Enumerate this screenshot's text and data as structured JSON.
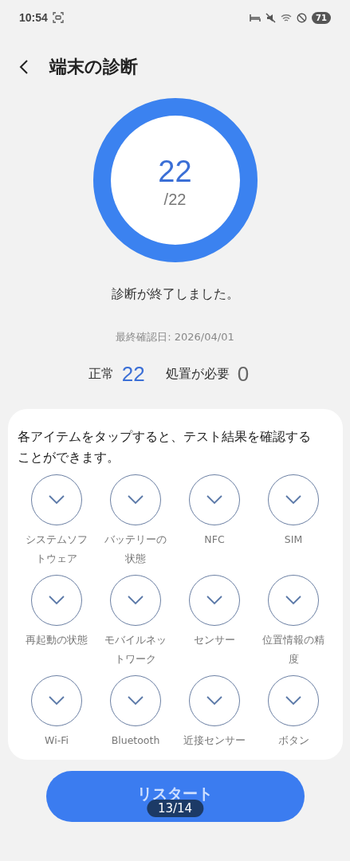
{
  "status_bar": {
    "time": "10:54",
    "battery": "71"
  },
  "header": {
    "title": "端末の診断"
  },
  "score": {
    "value": "22",
    "total": "/22",
    "level": 1
  },
  "message": "診断が終了しました。",
  "last_checked": "最終確認日: 2026/04/01",
  "counts": [
    {
      "label": "正常",
      "value": "22",
      "kind": "ok"
    },
    {
      "label": "処置が必要",
      "value": "0",
      "kind": "issue"
    }
  ],
  "card": {
    "instruction": "各アイテムをタップすると、テスト結果を確認することができます。",
    "items": [
      {
        "label": "システムソフトウェア",
        "passed": true
      },
      {
        "label": "バッテリーの状態",
        "passed": true
      },
      {
        "label": "NFC",
        "passed": true
      },
      {
        "label": "SIM",
        "passed": true
      },
      {
        "label": "再起動の状態",
        "passed": true
      },
      {
        "label": "モバイルネットワーク",
        "passed": true
      },
      {
        "label": "センサー",
        "passed": true
      },
      {
        "label": "位置情報の精度",
        "passed": true
      },
      {
        "label": "Wi-Fi",
        "passed": true
      },
      {
        "label": "Bluetooth",
        "passed": true
      },
      {
        "label": "近接センサー",
        "passed": true
      },
      {
        "label": "ボタン",
        "passed": true
      }
    ]
  },
  "button": {
    "label": "リスタート"
  },
  "page_indicator": "13/14"
}
